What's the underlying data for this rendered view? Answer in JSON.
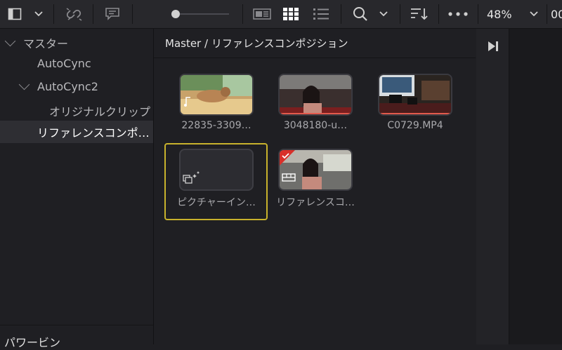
{
  "toolbar": {
    "zoom_level": "48%",
    "cut_text": "00"
  },
  "sidebar": {
    "items": [
      {
        "label": "マスター"
      },
      {
        "label": "AutoCync"
      },
      {
        "label": "AutoCync2"
      },
      {
        "label": "オリジナルクリップ"
      },
      {
        "label": "リファレンスコンポ…"
      }
    ],
    "bottom_label": "パワービン"
  },
  "content": {
    "breadcrumb": "Master / リファレンスコンポジション",
    "clips": [
      {
        "label": "22835-3309…"
      },
      {
        "label": "3048180-u…"
      },
      {
        "label": "C0729.MP4"
      },
      {
        "label": "ピクチャーイン…"
      },
      {
        "label": "リファレンスコ…"
      }
    ]
  },
  "colors": {
    "accent_selection": "#c8b22c",
    "check_badge": "#d8302a"
  }
}
